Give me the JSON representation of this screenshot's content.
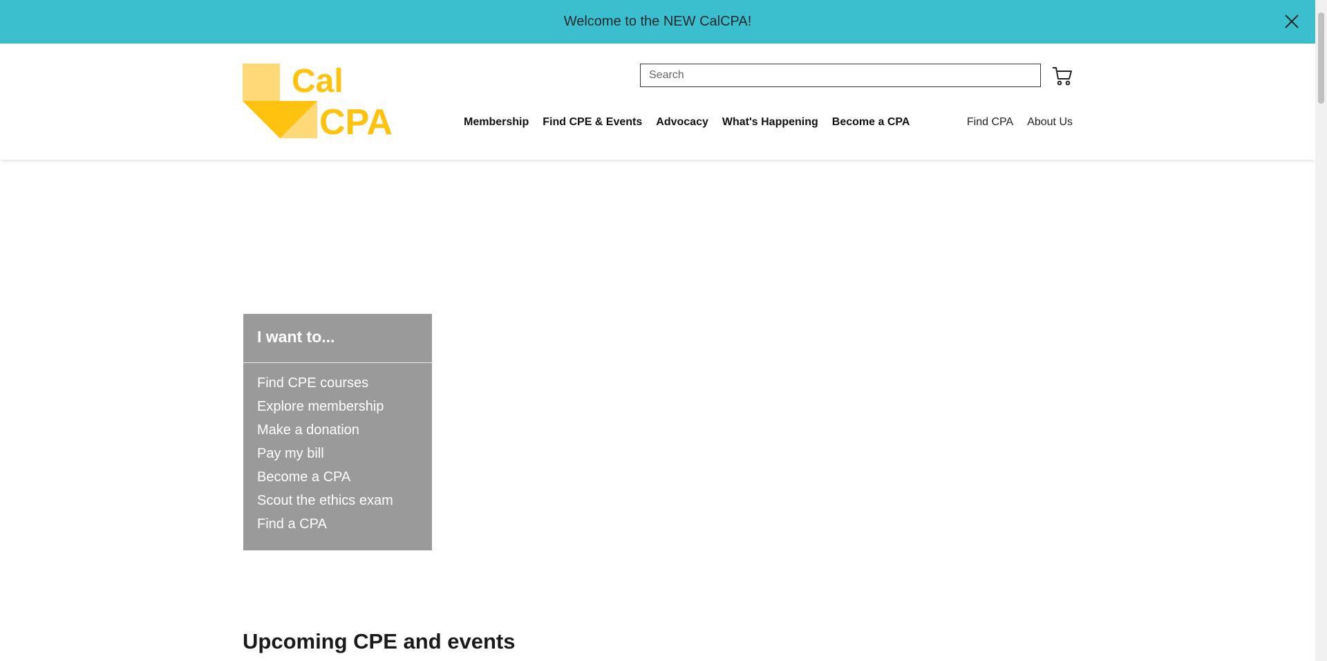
{
  "banner": {
    "text": "Welcome to the NEW CalCPA!",
    "close_icon": "close-icon",
    "color": "#3bbfcf"
  },
  "header": {
    "logo_text_line1": "Cal",
    "logo_text_line2": "CPA",
    "search_placeholder": "Search",
    "cart_icon": "shopping-cart-icon",
    "nav_main": [
      {
        "label": "Membership"
      },
      {
        "label": "Find CPE & Events"
      },
      {
        "label": "Advocacy"
      },
      {
        "label": "What's Happening"
      },
      {
        "label": "Become a CPA"
      }
    ],
    "nav_util": [
      {
        "label": "Find CPA"
      },
      {
        "label": "About Us"
      }
    ]
  },
  "want_box": {
    "title": "I want to...",
    "items": [
      {
        "label": "Find CPE courses"
      },
      {
        "label": "Explore membership"
      },
      {
        "label": "Make a donation"
      },
      {
        "label": "Pay my bill"
      },
      {
        "label": "Become a CPA"
      },
      {
        "label": "Scout the ethics exam"
      },
      {
        "label": "Find a CPA"
      }
    ]
  },
  "section_heading": "Upcoming CPE and events",
  "colors": {
    "brand_yellow": "#ffc20e",
    "brand_light_yellow": "#ffd978",
    "box_gray": "#9a9a9a"
  }
}
